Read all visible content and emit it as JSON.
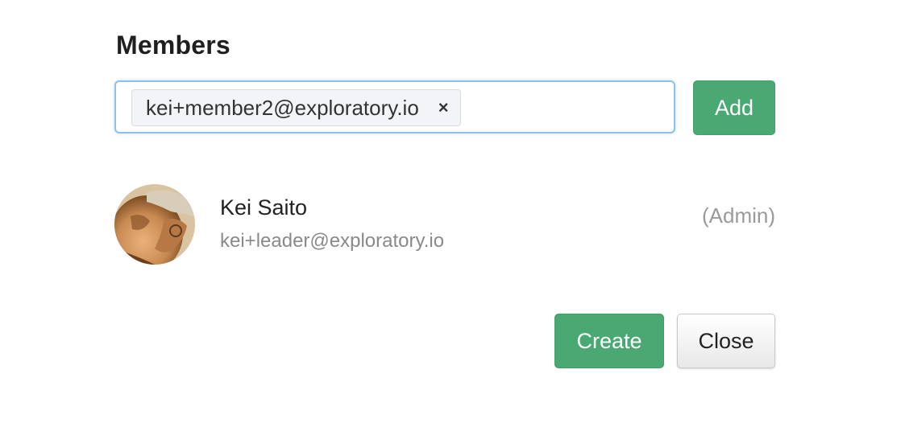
{
  "section": {
    "title": "Members"
  },
  "invite": {
    "tags": [
      "kei+member2@exploratory.io"
    ],
    "remove_symbol": "×",
    "add_label": "Add"
  },
  "members": [
    {
      "name": "Kei Saito",
      "email": "kei+leader@exploratory.io",
      "role": "(Admin)"
    }
  ],
  "footer": {
    "create_label": "Create",
    "close_label": "Close"
  },
  "colors": {
    "primary_green": "#4aa872",
    "focus_border": "#8fc0ec"
  }
}
